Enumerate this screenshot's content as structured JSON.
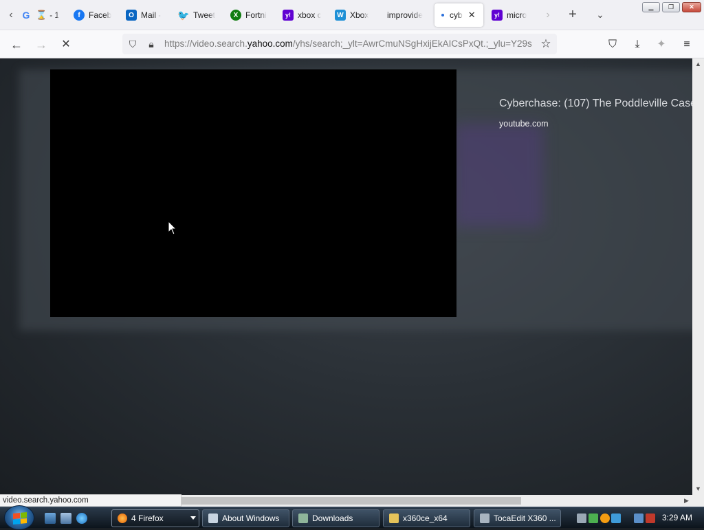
{
  "browser": {
    "tabs": [
      {
        "label": "- 1",
        "icon": "google-icon",
        "fav_color": "#ffffff",
        "fav_text": "G"
      },
      {
        "label": "Faceb",
        "icon": "facebook-icon",
        "fav_color": "#1877f2",
        "fav_text": "f"
      },
      {
        "label": "Mail -",
        "icon": "outlook-icon",
        "fav_color": "#0a66c2",
        "fav_text": "O"
      },
      {
        "label": "Tweet",
        "icon": "twitter-icon",
        "fav_color": "#1d9bf0",
        "fav_text": "t"
      },
      {
        "label": "Fortni",
        "icon": "xbox-icon",
        "fav_color": "#107c10",
        "fav_text": "X"
      },
      {
        "label": "xbox c",
        "icon": "yahoo-icon",
        "fav_color": "#6001d2",
        "fav_text": "y!"
      },
      {
        "label": "Xbox",
        "icon": "wordpress-w-icon",
        "fav_color": "#1e90d6",
        "fav_text": "W"
      },
      {
        "label": "improvide",
        "icon": "",
        "fav_color": "",
        "fav_text": ""
      },
      {
        "label": "cyb",
        "icon": "loading-dot-icon",
        "fav_color": "",
        "fav_text": "",
        "active": true
      },
      {
        "label": "micro",
        "icon": "yahoo-icon",
        "fav_color": "#6001d2",
        "fav_text": "y!"
      }
    ],
    "url": {
      "prefix": "https://video.search.",
      "host": "yahoo.com",
      "rest": "/yhs/search;_ylt=AwrCmuNSgHxijEkAICsPxQt.;_ylu=Y29s"
    },
    "status_text": "video.search.yahoo.com"
  },
  "page": {
    "video_title": "Cyberchase: (107) The Poddleville Case",
    "video_source": "youtube.com"
  },
  "taskbar": {
    "buttons": [
      {
        "label": "4 Firefox",
        "icon": "firefox-icon",
        "color": "#e66000"
      },
      {
        "label": "About Windows",
        "icon": "window-icon",
        "color": "#c8d4e0"
      },
      {
        "label": "Downloads",
        "icon": "folder-icon",
        "color": "#8fb59a"
      },
      {
        "label": "x360ce_x64",
        "icon": "folder-icon",
        "color": "#e5c35a"
      },
      {
        "label": "TocaEdit X360 ...",
        "icon": "gamepad-icon",
        "color": "#a8b4c0"
      }
    ],
    "clock": "3:29 AM"
  },
  "colors": {
    "accent": "#2a6fdb",
    "taskbar": "#0c141c"
  }
}
